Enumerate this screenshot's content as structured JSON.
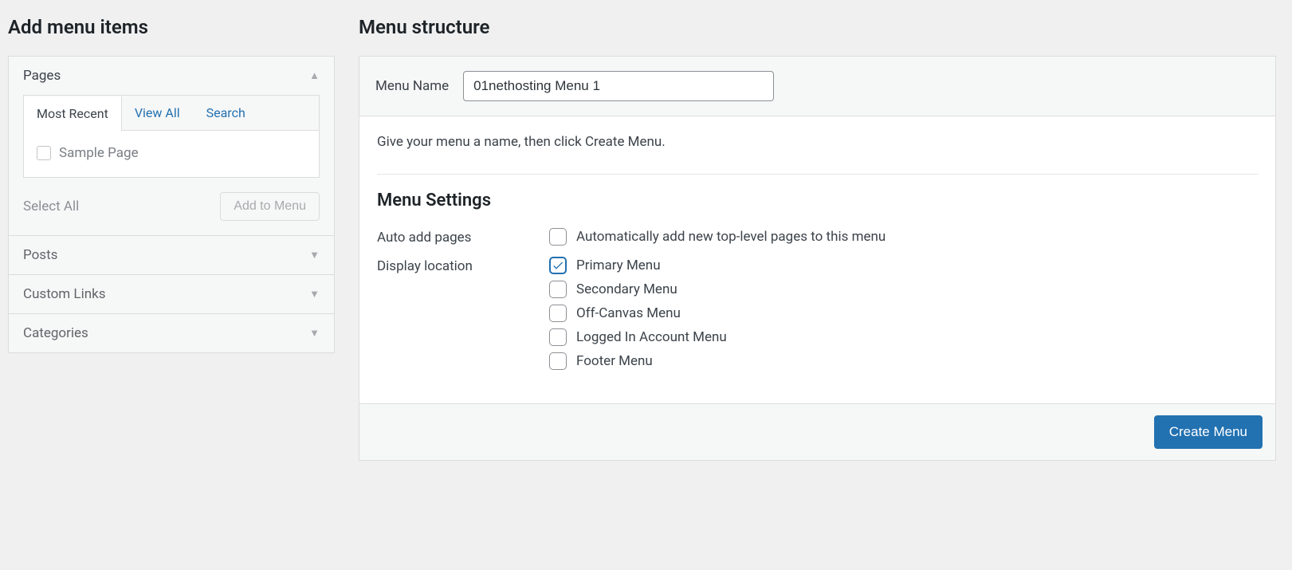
{
  "left": {
    "title": "Add menu items",
    "sections": {
      "pages": "Pages",
      "posts": "Posts",
      "custom_links": "Custom Links",
      "categories": "Categories"
    },
    "tabs": {
      "most_recent": "Most Recent",
      "view_all": "View All",
      "search": "Search"
    },
    "sample_item": "Sample Page",
    "select_all": "Select All",
    "add_to_menu": "Add to Menu"
  },
  "right": {
    "title": "Menu structure",
    "menu_name_label": "Menu Name",
    "menu_name_value": "01nethosting Menu 1",
    "help": "Give your menu a name, then click Create Menu.",
    "settings_title": "Menu Settings",
    "auto_add_label": "Auto add pages",
    "auto_add_option": "Automatically add new top-level pages to this menu",
    "display_loc_label": "Display location",
    "locations": {
      "primary": "Primary Menu",
      "secondary": "Secondary Menu",
      "offcanvas": "Off-Canvas Menu",
      "account": "Logged In Account Menu",
      "footer": "Footer Menu"
    },
    "create_btn": "Create Menu"
  }
}
